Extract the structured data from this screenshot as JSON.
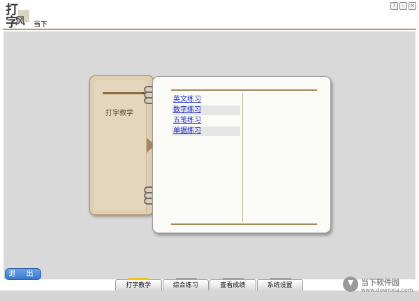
{
  "app": {
    "logo_main": "打字",
    "logo_sub": "风",
    "title": "当下",
    "window_buttons": [
      "?",
      "–",
      "×"
    ]
  },
  "cover": {
    "title": "打字教学"
  },
  "menu": {
    "items": [
      "英文练习",
      "数字练习",
      "五笔练习",
      "单据练习"
    ]
  },
  "exit_label": "退 出",
  "tabs": [
    {
      "label": "打字教学",
      "active": true
    },
    {
      "label": "综合练习",
      "active": false
    },
    {
      "label": "查看成绩",
      "active": false
    },
    {
      "label": "系统设置",
      "active": false
    }
  ],
  "watermark": {
    "name": "当下软件园",
    "url": "www.downxia.com"
  },
  "colors": {
    "accent": "#b39b6a",
    "cover": "#dfcfb2",
    "link": "#1a2bd0",
    "active_tab_marker": "#f0c419",
    "exit_button": "#3877cc"
  }
}
